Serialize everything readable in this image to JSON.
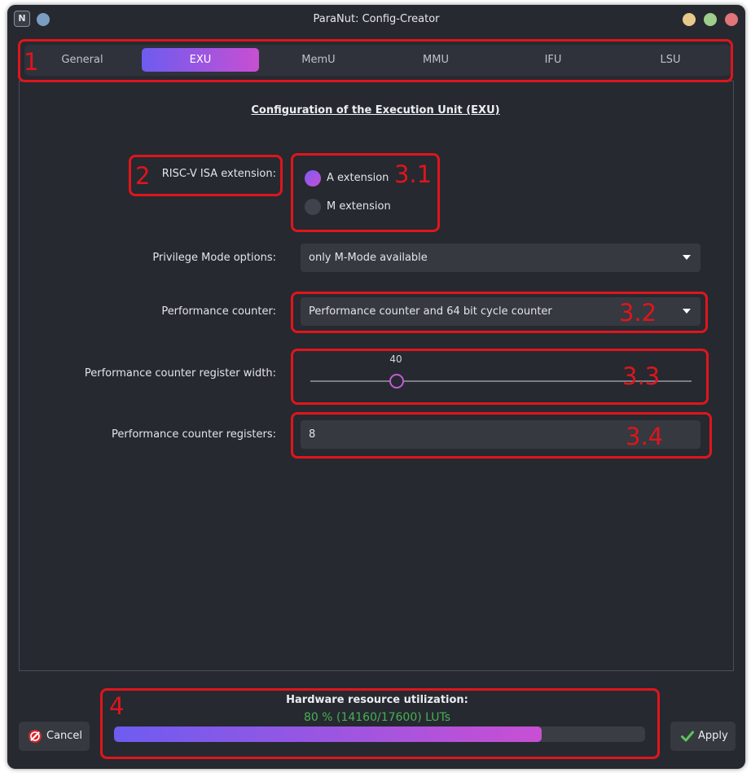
{
  "window": {
    "title": "ParaNut: Config-Creator",
    "app_icon_glyph": "N",
    "icons": [
      "app-icon",
      "pin-icon",
      "minimize-icon",
      "maximize-icon",
      "close-icon"
    ],
    "button_colors": {
      "minimize": "#e7c98c",
      "maximize": "#9fcd8c",
      "close": "#e0757a"
    }
  },
  "tabs": [
    {
      "label": "General",
      "active": false
    },
    {
      "label": "EXU",
      "active": true
    },
    {
      "label": "MemU",
      "active": false
    },
    {
      "label": "MMU",
      "active": false
    },
    {
      "label": "IFU",
      "active": false
    },
    {
      "label": "LSU",
      "active": false
    }
  ],
  "accent_gradient": [
    "#6d5cf0",
    "#c84fd3"
  ],
  "heading": "Configuration of the Execution Unit (EXU)",
  "isa": {
    "label": "RISC-V ISA extension:",
    "options": [
      {
        "label": "A extension",
        "checked": true
      },
      {
        "label": "M extension",
        "checked": false
      }
    ]
  },
  "privilege": {
    "label": "Privilege Mode options:",
    "value": "only M-Mode available"
  },
  "perf_counter": {
    "label": "Performance counter:",
    "value": "Performance counter and 64 bit cycle counter"
  },
  "perf_width": {
    "label": "Performance counter register width:",
    "value": "40"
  },
  "perf_regs": {
    "label": "Performance counter registers:",
    "value": "8"
  },
  "annotations": {
    "color": "#e0151c",
    "labels": [
      "1",
      "2",
      "3.1",
      "3.2",
      "3.3",
      "3.4",
      "4"
    ]
  },
  "footer": {
    "cancel_label": "Cancel",
    "apply_label": "Apply",
    "hw_title": "Hardware resource utilization:",
    "hw_text": "80 % (14160/17600) LUTs",
    "hw_fraction": 0.8045,
    "hw_text_color": "#47b054"
  }
}
